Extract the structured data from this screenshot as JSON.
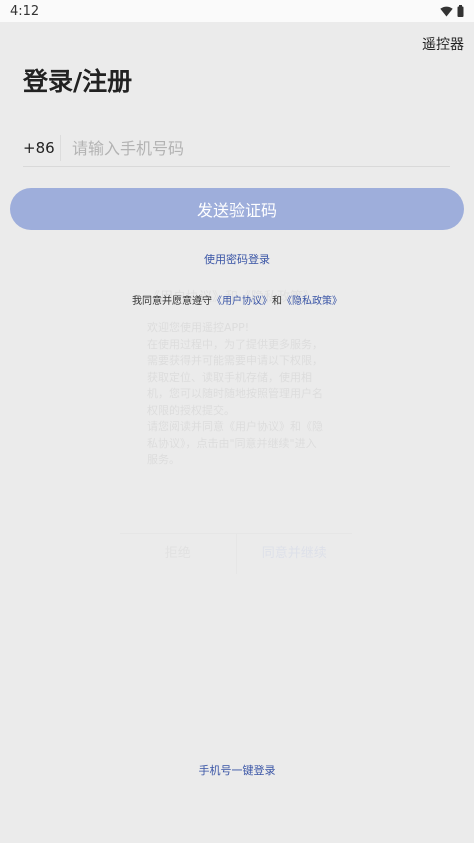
{
  "status_bar": {
    "time": "4:12"
  },
  "header": {
    "remote_label": "遥控器",
    "title": "登录/注册"
  },
  "phone_field": {
    "country_code": "+86",
    "placeholder": "请输入手机号码"
  },
  "send_code_label": "发送验证码",
  "password_login_label": "使用密码登录",
  "agreement": {
    "prefix": "我同意并愿意遵守",
    "user_agreement": "《用户协议》",
    "and": "和",
    "privacy_policy": "《隐私政策》"
  },
  "faded_dialog": {
    "title": "《用户协议》和《隐私政策》",
    "body": "欢迎您使用遥控APP!\n在使用过程中，为了提供更多服务，需要获得并可能需要申请以下权限，获取定位、读取手机存储，使用相机，您可以随时随地按照管理用户名权限的授权提交。\n请您阅读并同意《用户协议》和《隐私协议》，点击由\"同意并继续\"进入服务。",
    "refuse_label": "拒绝",
    "agree_label": "同意并继续"
  },
  "one_click_login_label": "手机号一键登录",
  "colors": {
    "accent": "#3a55a6",
    "button_bg": "#9eaedb",
    "background": "#ebebeb"
  }
}
